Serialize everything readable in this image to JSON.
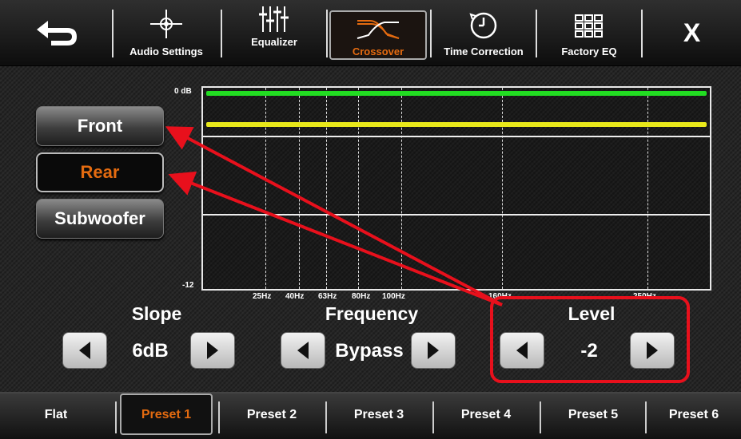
{
  "accent_color": "#e46b10",
  "header": {
    "back_icon": "back-arrow-icon",
    "tabs": [
      {
        "label": "Audio Settings",
        "icon": "crosshair-icon"
      },
      {
        "label": "Equalizer",
        "icon": "sliders-icon"
      },
      {
        "label": "Crossover",
        "icon": "crossover-curve-icon",
        "active": true
      },
      {
        "label": "Time Correction",
        "icon": "clock-icon"
      },
      {
        "label": "Factory EQ",
        "icon": "grid-icon"
      }
    ],
    "close_label": "X"
  },
  "channels": [
    {
      "label": "Front",
      "active": false
    },
    {
      "label": "Rear",
      "active": true
    },
    {
      "label": "Subwoofer",
      "active": false
    }
  ],
  "graph": {
    "y_top_label": "0 dB",
    "y_bottom_label": "-12",
    "x_labels": [
      "25Hz",
      "40Hz",
      "63Hz",
      "80Hz",
      "100Hz",
      "160Hz",
      "250Hz"
    ],
    "curve_colors": [
      "#22dd22",
      "#e8e81a"
    ]
  },
  "controls": {
    "slope": {
      "title": "Slope",
      "value": "6dB"
    },
    "frequency": {
      "title": "Frequency",
      "value": "Bypass"
    },
    "level": {
      "title": "Level",
      "value": "-2"
    }
  },
  "annotation_color": "#e8101c",
  "presets": [
    "Flat",
    "Preset 1",
    "Preset 2",
    "Preset 3",
    "Preset 4",
    "Preset 5",
    "Preset 6"
  ],
  "active_preset": "Preset 1"
}
